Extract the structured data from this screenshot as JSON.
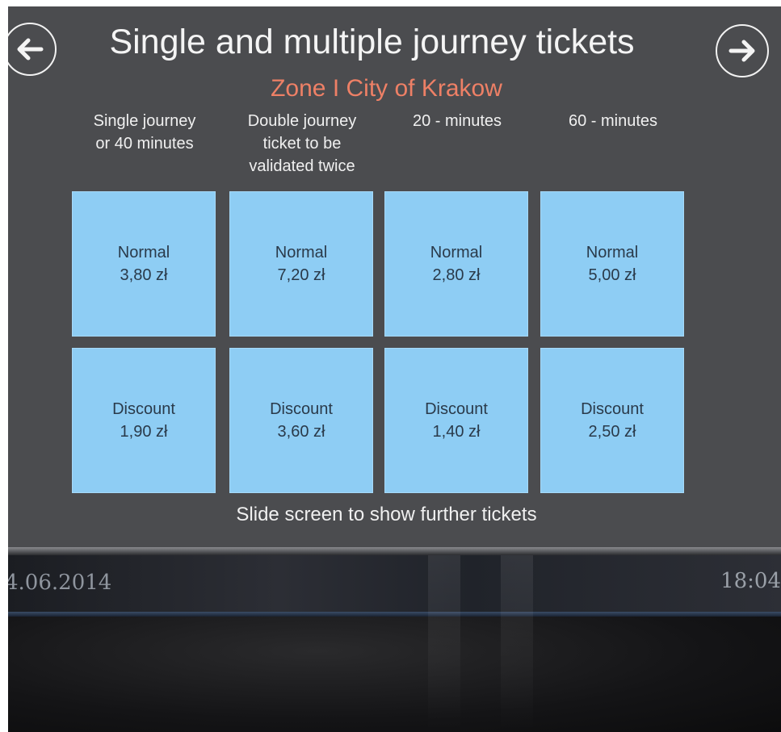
{
  "header": {
    "title": "Single and multiple journey tickets",
    "subtitle": "Zone I City of Krakow"
  },
  "nav": {
    "prev_icon": "arrow-left-icon",
    "next_icon": "arrow-right-icon"
  },
  "columns": [
    {
      "label": "Single journey\nor 40 minutes"
    },
    {
      "label": "Double journey\nticket to be\nvalidated twice"
    },
    {
      "label": "20 - minutes"
    },
    {
      "label": "60 - minutes"
    }
  ],
  "tickets": {
    "normal": [
      {
        "type": "Normal",
        "price": "3,80 zł"
      },
      {
        "type": "Normal",
        "price": "7,20 zł"
      },
      {
        "type": "Normal",
        "price": "2,80 zł"
      },
      {
        "type": "Normal",
        "price": "5,00 zł"
      }
    ],
    "discount": [
      {
        "type": "Discount",
        "price": "1,90 zł"
      },
      {
        "type": "Discount",
        "price": "3,60 zł"
      },
      {
        "type": "Discount",
        "price": "1,40 zł"
      },
      {
        "type": "Discount",
        "price": "2,50 zł"
      }
    ]
  },
  "footer": {
    "hint": "Slide screen to show further tickets"
  },
  "status": {
    "date": "4.06.2014",
    "time": "18:04"
  },
  "colors": {
    "background": "#4b4c4f",
    "tile": "#8ecdf4",
    "subtitle": "#ee8066",
    "text": "#f0f0f0"
  }
}
